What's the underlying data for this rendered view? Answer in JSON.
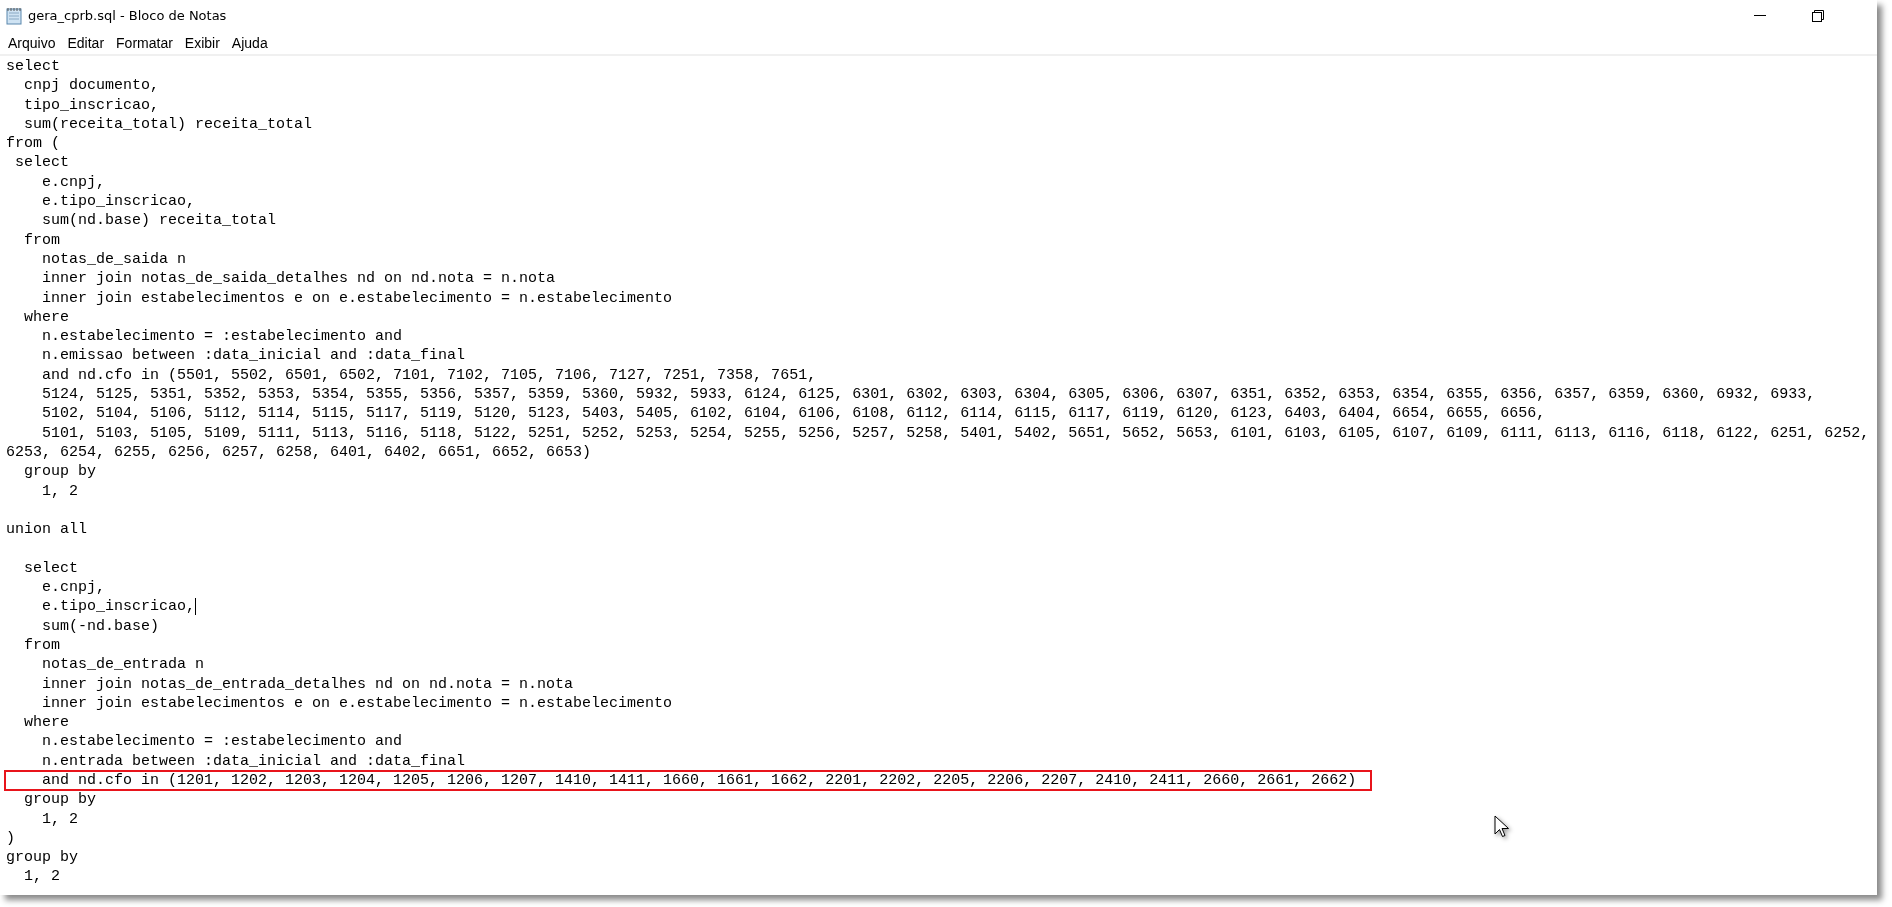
{
  "window": {
    "title": "gera_cprb.sql - Bloco de Notas"
  },
  "menu": [
    "Arquivo",
    "Editar",
    "Formatar",
    "Exibir",
    "Ajuda"
  ],
  "lines": [
    {
      "text": "select",
      "boxed": false,
      "cursor": false
    },
    {
      "text": "  cnpj documento,",
      "boxed": false,
      "cursor": false
    },
    {
      "text": "  tipo_inscricao,",
      "boxed": false,
      "cursor": false
    },
    {
      "text": "  sum(receita_total) receita_total",
      "boxed": false,
      "cursor": false
    },
    {
      "text": "from (",
      "boxed": false,
      "cursor": false
    },
    {
      "text": " select",
      "boxed": false,
      "cursor": false
    },
    {
      "text": "    e.cnpj,",
      "boxed": false,
      "cursor": false
    },
    {
      "text": "    e.tipo_inscricao,",
      "boxed": false,
      "cursor": false
    },
    {
      "text": "    sum(nd.base) receita_total",
      "boxed": false,
      "cursor": false
    },
    {
      "text": "  from",
      "boxed": false,
      "cursor": false
    },
    {
      "text": "    notas_de_saida n",
      "boxed": false,
      "cursor": false
    },
    {
      "text": "    inner join notas_de_saida_detalhes nd on nd.nota = n.nota",
      "boxed": false,
      "cursor": false
    },
    {
      "text": "    inner join estabelecimentos e on e.estabelecimento = n.estabelecimento",
      "boxed": false,
      "cursor": false
    },
    {
      "text": "  where",
      "boxed": false,
      "cursor": false
    },
    {
      "text": "    n.estabelecimento = :estabelecimento and",
      "boxed": false,
      "cursor": false
    },
    {
      "text": "    n.emissao between :data_inicial and :data_final",
      "boxed": false,
      "cursor": false
    },
    {
      "text": "    and nd.cfo in (5501, 5502, 6501, 6502, 7101, 7102, 7105, 7106, 7127, 7251, 7358, 7651,",
      "boxed": false,
      "cursor": false
    },
    {
      "text": "    5124, 5125, 5351, 5352, 5353, 5354, 5355, 5356, 5357, 5359, 5360, 5932, 5933, 6124, 6125, 6301, 6302, 6303, 6304, 6305, 6306, 6307, 6351, 6352, 6353, 6354, 6355, 6356, 6357, 6359, 6360, 6932, 6933,",
      "boxed": false,
      "cursor": false
    },
    {
      "text": "    5102, 5104, 5106, 5112, 5114, 5115, 5117, 5119, 5120, 5123, 5403, 5405, 6102, 6104, 6106, 6108, 6112, 6114, 6115, 6117, 6119, 6120, 6123, 6403, 6404, 6654, 6655, 6656,",
      "boxed": false,
      "cursor": false
    },
    {
      "text": "    5101, 5103, 5105, 5109, 5111, 5113, 5116, 5118, 5122, 5251, 5252, 5253, 5254, 5255, 5256, 5257, 5258, 5401, 5402, 5651, 5652, 5653, 6101, 6103, 6105, 6107, 6109, 6111, 6113, 6116, 6118, 6122, 6251, 6252,",
      "boxed": false,
      "cursor": false
    },
    {
      "text": "6253, 6254, 6255, 6256, 6257, 6258, 6401, 6402, 6651, 6652, 6653)",
      "boxed": false,
      "cursor": false
    },
    {
      "text": "  group by",
      "boxed": false,
      "cursor": false
    },
    {
      "text": "    1, 2",
      "boxed": false,
      "cursor": false
    },
    {
      "boxed": false,
      "cursor": false
    },
    {
      "text": "union all",
      "boxed": false,
      "cursor": false
    },
    {
      "boxed": false,
      "cursor": false
    },
    {
      "text": "  select",
      "boxed": false,
      "cursor": false
    },
    {
      "text": "    e.cnpj,",
      "boxed": false,
      "cursor": false
    },
    {
      "text": "    e.tipo_inscricao,",
      "boxed": false,
      "cursor": true
    },
    {
      "text": "    sum(-nd.base)",
      "boxed": false,
      "cursor": false
    },
    {
      "text": "  from",
      "boxed": false,
      "cursor": false
    },
    {
      "text": "    notas_de_entrada n",
      "boxed": false,
      "cursor": false
    },
    {
      "text": "    inner join notas_de_entrada_detalhes nd on nd.nota = n.nota",
      "boxed": false,
      "cursor": false
    },
    {
      "text": "    inner join estabelecimentos e on e.estabelecimento = n.estabelecimento",
      "boxed": false,
      "cursor": false
    },
    {
      "text": "  where",
      "boxed": false,
      "cursor": false
    },
    {
      "text": "    n.estabelecimento = :estabelecimento and",
      "boxed": false,
      "cursor": false
    },
    {
      "text": "    n.entrada between :data_inicial and :data_final",
      "boxed": false,
      "cursor": false
    },
    {
      "text": "    and nd.cfo in (1201, 1202, 1203, 1204, 1205, 1206, 1207, 1410, 1411, 1660, 1661, 1662, 2201, 2202, 2205, 2206, 2207, 2410, 2411, 2660, 2661, 2662)",
      "boxed": true,
      "cursor": false
    },
    {
      "text": "  group by",
      "boxed": false,
      "cursor": false
    },
    {
      "text": "    1, 2",
      "boxed": false,
      "cursor": false
    },
    {
      "text": ")",
      "boxed": false,
      "cursor": false
    },
    {
      "text": "group by",
      "boxed": false,
      "cursor": false
    },
    {
      "text": "  1, 2",
      "boxed": false,
      "cursor": false
    }
  ]
}
